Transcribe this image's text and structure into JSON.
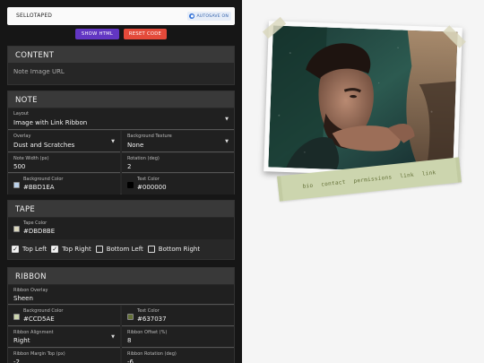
{
  "app": {
    "title": "SELLOTAPED",
    "autosave_label": "AUTOSAVE ON"
  },
  "buttons": {
    "show_html": "SHOW HTML",
    "reset_code": "RESET CODE"
  },
  "content": {
    "header": "CONTENT",
    "image_url_placeholder": "Note Image URL"
  },
  "note": {
    "header": "NOTE",
    "layout_label": "Layout",
    "layout_value": "Image with Link Ribbon",
    "overlay_label": "Overlay",
    "overlay_value": "Dust and Scratches",
    "bg_texture_label": "Background Texture",
    "bg_texture_value": "None",
    "width_label": "Note Width (px)",
    "width_value": "500",
    "rotation_label": "Rotation (deg)",
    "rotation_value": "2",
    "bg_color_label": "Background Color",
    "bg_color_value": "#BBD1EA",
    "text_color_label": "Text Color",
    "text_color_value": "#000000"
  },
  "tape": {
    "header": "TAPE",
    "color_label": "Tape Color",
    "color_value": "#DBD8BE",
    "positions": [
      {
        "label": "Top Left",
        "checked": true
      },
      {
        "label": "Top Right",
        "checked": true
      },
      {
        "label": "Bottom Left",
        "checked": false
      },
      {
        "label": "Bottom Right",
        "checked": false
      }
    ]
  },
  "ribbon": {
    "header": "RIBBON",
    "overlay_label": "Ribbon Overlay",
    "overlay_value": "Sheen",
    "bg_color_label": "Background Color",
    "bg_color_value": "#CCD5AE",
    "text_color_label": "Text Color",
    "text_color_value": "#637037",
    "alignment_label": "Ribbon Alignment",
    "alignment_value": "Right",
    "offset_label": "Ribbon Offset (%)",
    "offset_value": "8",
    "margin_top_label": "Ribbon Margin Top (px)",
    "margin_top_value": "-2",
    "rotation_label": "Ribbon Rotation (deg)",
    "rotation_value": "-6"
  },
  "preview": {
    "links": [
      "bio",
      "contact",
      "permissions",
      "link",
      "link"
    ]
  }
}
